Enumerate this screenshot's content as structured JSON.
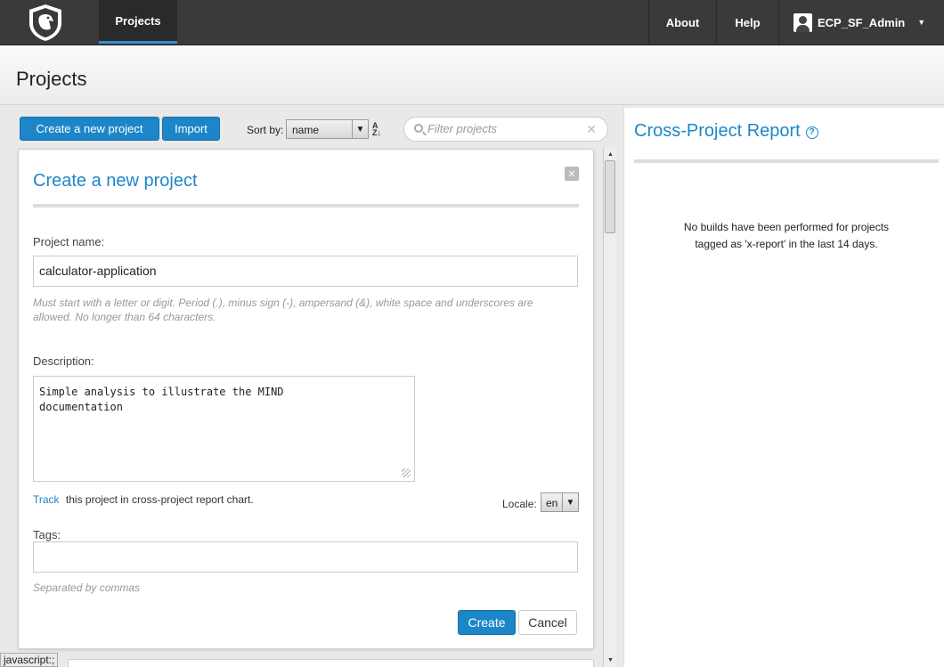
{
  "nav": {
    "projects_label": "Projects",
    "about_label": "About",
    "help_label": "Help",
    "user_label": "ECP_SF_Admin",
    "accent_color": "#2d8fd0"
  },
  "header": {
    "title": "Projects"
  },
  "toolbar": {
    "create_label": "Create a new project",
    "import_label": "Import",
    "sort_label": "Sort by:",
    "sort_value": "name",
    "filter_placeholder": "Filter projects"
  },
  "form": {
    "title": "Create a new project",
    "name_label": "Project name:",
    "name_value": "calculator-application",
    "name_hint": "Must start with a letter or digit. Period (.), minus sign (-), ampersand (&), white space and underscores are allowed. No longer than 64 characters.",
    "description_label": "Description:",
    "description_value": "Simple analysis to illustrate the MIND\ndocumentation",
    "track_link": "Track",
    "track_text": "this project in cross-project report chart.",
    "locale_label": "Locale:",
    "locale_value": "en",
    "tags_label": "Tags:",
    "tags_value": "",
    "tags_hint": "Separated by commas",
    "create_button": "Create",
    "cancel_button": "Cancel"
  },
  "report": {
    "title": "Cross-Project Report",
    "message": "No builds have been performed for projects tagged as 'x-report' in the last 14 days."
  },
  "statusbar": {
    "text": "javascript:;"
  }
}
